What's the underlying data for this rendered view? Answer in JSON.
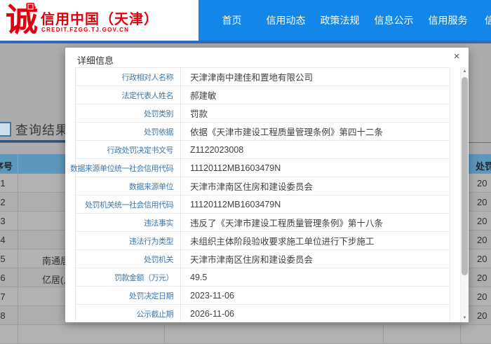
{
  "header": {
    "logo_glyph": "诚",
    "site_name": "信用中国（天津）",
    "site_domain": "CREDIT.FZGG.TJ.GOV.CN",
    "nav_items": [
      {
        "label": "首页"
      },
      {
        "label": "信用动态"
      },
      {
        "label": "政策法规"
      },
      {
        "label": "信息公示"
      },
      {
        "label": "信用服务"
      },
      {
        "label": "信"
      }
    ]
  },
  "page": {
    "section_title": "查询结果",
    "results_table": {
      "header_left": "序号",
      "header_right": "处罚",
      "rows": [
        {
          "num": "1",
          "fragment": "",
          "date": "20"
        },
        {
          "num": "2",
          "fragment": "",
          "date": "20"
        },
        {
          "num": "3",
          "fragment": "",
          "date": "20"
        },
        {
          "num": "4",
          "fragment": "",
          "date": "20"
        },
        {
          "num": "5",
          "fragment": "南通居",
          "date": "20"
        },
        {
          "num": "6",
          "fragment": "亿居(上",
          "date": "20"
        },
        {
          "num": "7",
          "fragment": "",
          "date": "20"
        },
        {
          "num": "8",
          "fragment": "",
          "date": "20"
        }
      ]
    }
  },
  "modal": {
    "title": "详细信息",
    "close_label": "×",
    "scroll_up": "▲",
    "scroll_down": "▼",
    "fields": [
      {
        "label": "行政相对人名称",
        "value": "天津津南中建佳和置地有限公司"
      },
      {
        "label": "法定代表人姓名",
        "value": "郝建敏"
      },
      {
        "label": "处罚类别",
        "value": "罚款"
      },
      {
        "label": "处罚依据",
        "value": "依据《天津市建设工程质量管理条例》第四十二条"
      },
      {
        "label": "行政处罚决定书文号",
        "value": "Z1122023008"
      },
      {
        "label": "数据来源单位统一社会信用代码",
        "value": "11120112MB1603479N"
      },
      {
        "label": "数据来源单位",
        "value": "天津市津南区住房和建设委员会"
      },
      {
        "label": "处罚机关统一社会信用代码",
        "value": "11120112MB1603479N"
      },
      {
        "label": "违法事实",
        "value": "违反了《天津市建设工程质量管理条例》第十八条"
      },
      {
        "label": "违法行为类型",
        "value": "未组织主体阶段验收要求施工单位进行下步施工"
      },
      {
        "label": "处罚机关",
        "value": "天津市津南区住房和建设委员会"
      },
      {
        "label": "罚款金额（万元）",
        "value": "49.5"
      },
      {
        "label": "处罚决定日期",
        "value": "2023-11-06"
      },
      {
        "label": "公示截止期",
        "value": "2026-11-06"
      }
    ]
  },
  "colors": {
    "brand_red": "#e2000f",
    "nav_blue": "#1286e9",
    "strip_blue": "#3269bb",
    "table_header_blue": "#5e97bc",
    "modal_label_blue": "#4076a8"
  }
}
